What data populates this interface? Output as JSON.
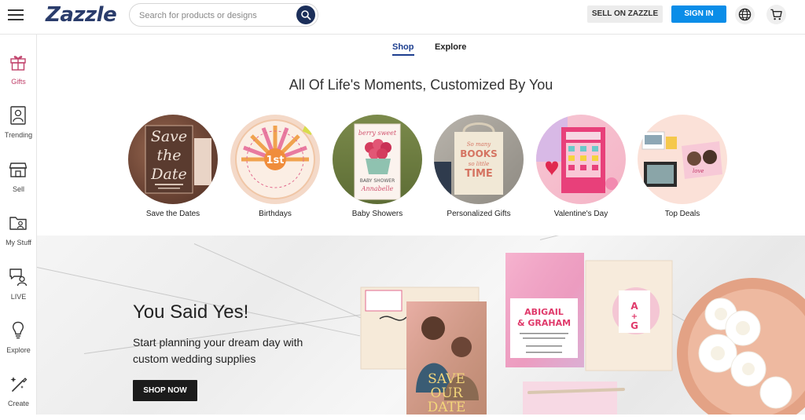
{
  "header": {
    "logo": "Zazzle",
    "search_placeholder": "Search for products or designs",
    "sell_label": "SELL ON ZAZZLE",
    "signin_label": "SIGN IN"
  },
  "sidebar": {
    "items": [
      {
        "label": "Gifts",
        "icon": "gift-icon"
      },
      {
        "label": "Trending",
        "icon": "trending-icon"
      },
      {
        "label": "Sell",
        "icon": "store-icon"
      },
      {
        "label": "My Stuff",
        "icon": "folder-user-icon"
      },
      {
        "label": "LIVE",
        "icon": "live-chat-icon"
      },
      {
        "label": "Explore",
        "icon": "lightbulb-icon"
      },
      {
        "label": "Create",
        "icon": "magic-pen-icon"
      }
    ]
  },
  "tabs": [
    {
      "label": "Shop",
      "active": true
    },
    {
      "label": "Explore",
      "active": false
    }
  ],
  "headline": "All Of Life's Moments, Customized By You",
  "categories": [
    {
      "label": "Save the Dates"
    },
    {
      "label": "Birthdays"
    },
    {
      "label": "Baby Showers"
    },
    {
      "label": "Personalized Gifts"
    },
    {
      "label": "Valentine's Day"
    },
    {
      "label": "Top Deals"
    }
  ],
  "hero": {
    "title": "You Said Yes!",
    "subtitle": "Start planning your dream day with custom wedding supplies",
    "cta_label": "SHOP NOW",
    "card_names": "ABIGAIL & GRAHAM",
    "card_initials": "A + G",
    "save_date_text": "SAVE OUR DATE"
  },
  "colors": {
    "brand_navy": "#2a3c6b",
    "signin_blue": "#0a8de8",
    "active_tab": "#1c3e8f",
    "gifts_pink": "#c0406a"
  }
}
